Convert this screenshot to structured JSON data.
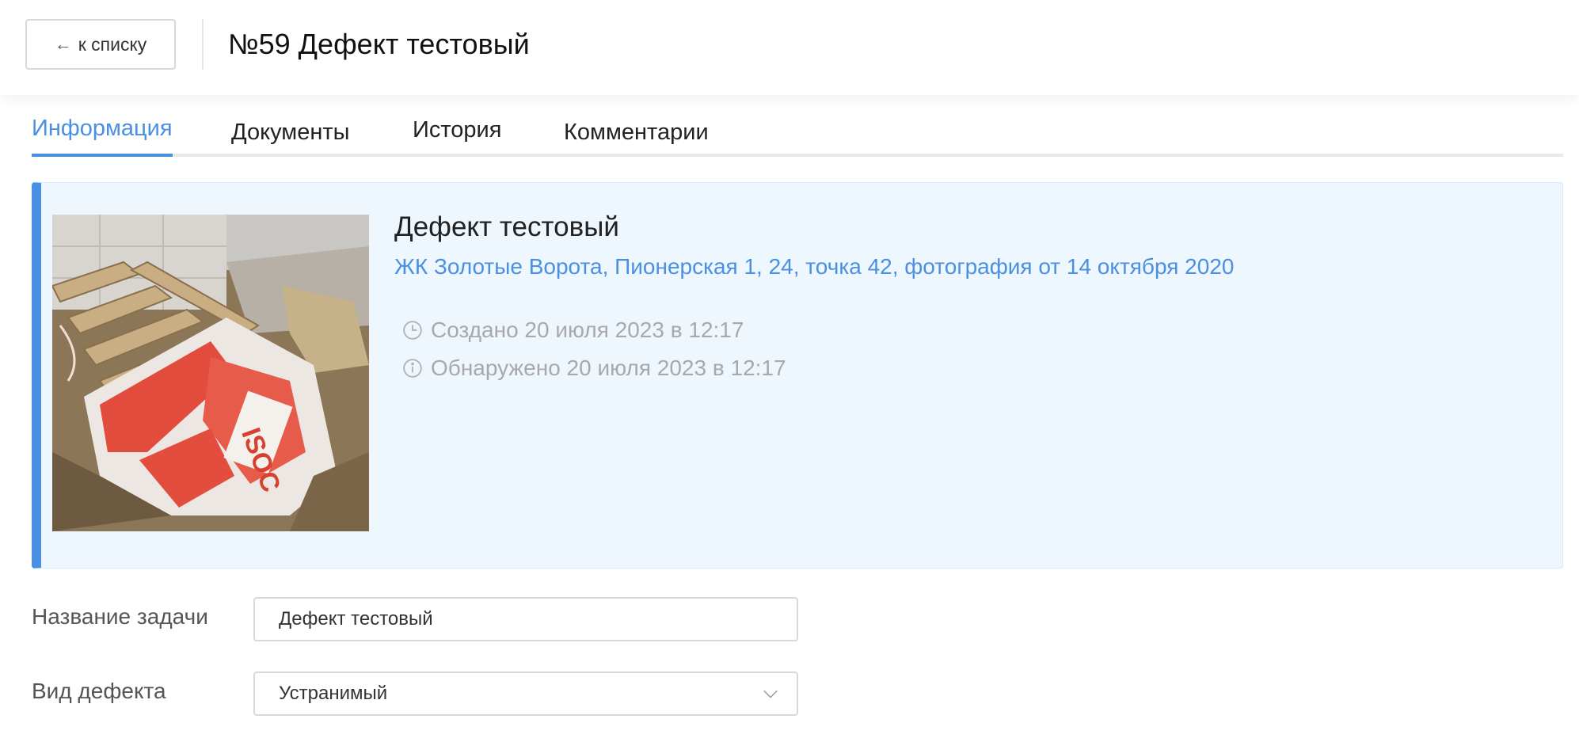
{
  "header": {
    "back_label": "к списку",
    "title": "№59 Дефект тестовый"
  },
  "tabs": [
    {
      "label": "Информация",
      "active": true
    },
    {
      "label": "Документы",
      "active": false
    },
    {
      "label": "История",
      "active": false
    },
    {
      "label": "Комментарии",
      "active": false
    }
  ],
  "card": {
    "title": "Дефект тестовый",
    "location_link": "ЖК Золотые Ворота, Пионерская 1, 24, точка 42, фотография от 14 октября 2020",
    "created": "Создано 20 июля 2023 в 12:17",
    "detected": "Обнаружено 20 июля 2023 в 12:17"
  },
  "form": {
    "task_name_label": "Название задачи",
    "task_name_value": "Дефект тестовый",
    "defect_type_label": "Вид дефекта",
    "defect_type_value": "Устранимый"
  },
  "colors": {
    "accent": "#4a90e2",
    "card_bg": "#eef6fe",
    "muted": "#a9a9a9"
  },
  "icons": {
    "back": "arrow-left-icon",
    "created": "clock-icon",
    "detected": "info-icon",
    "select": "chevron-down-icon"
  }
}
